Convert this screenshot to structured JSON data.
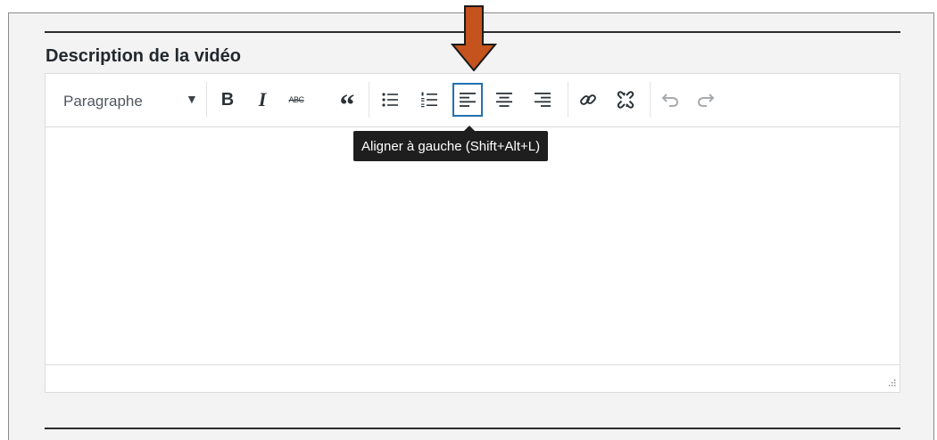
{
  "section": {
    "title": "Description de la vidéo"
  },
  "toolbar": {
    "format_select": {
      "value": "Paragraphe"
    },
    "buttons": [
      {
        "name": "bold-button",
        "icon": "bold-icon",
        "glyph": "B"
      },
      {
        "name": "italic-button",
        "icon": "italic-icon",
        "glyph": "I"
      },
      {
        "name": "strikethrough-button",
        "icon": "strikethrough-icon",
        "glyph": "ABC"
      },
      {
        "name": "blockquote-button",
        "icon": "quote-icon",
        "glyph": "“"
      },
      {
        "name": "bullet-list-button",
        "icon": "bullet-list-icon"
      },
      {
        "name": "numbered-list-button",
        "icon": "numbered-list-icon"
      },
      {
        "name": "align-left-button",
        "icon": "align-left-icon",
        "active": true
      },
      {
        "name": "align-center-button",
        "icon": "align-center-icon"
      },
      {
        "name": "align-right-button",
        "icon": "align-right-icon"
      },
      {
        "name": "insert-link-button",
        "icon": "link-icon"
      },
      {
        "name": "remove-link-button",
        "icon": "unlink-icon"
      },
      {
        "name": "undo-button",
        "icon": "undo-icon",
        "disabled": true
      },
      {
        "name": "redo-button",
        "icon": "redo-icon",
        "disabled": true
      }
    ]
  },
  "tooltip": {
    "text": "Aligner à gauche (Shift+Alt+L)"
  },
  "colors": {
    "active_border": "#2271b1",
    "tooltip_bg": "#1e1e1e",
    "pointer_arrow_fill": "#c4531d",
    "panel_bg": "#f3f3f3"
  }
}
